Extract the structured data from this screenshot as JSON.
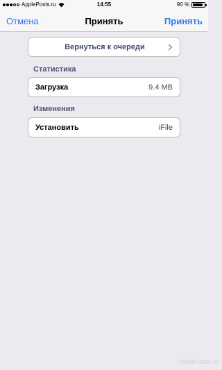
{
  "status_bar": {
    "carrier": "ApplePosts.ru",
    "time": "14:55",
    "battery": "90 %",
    "battery_level": 0.9
  },
  "nav": {
    "cancel_label": "Отмена",
    "title": "Принять",
    "accept_label": "Принять",
    "accent_color": "#3478f6"
  },
  "return_button": {
    "label": "Вернуться к очереди",
    "icon": "chevron-right-icon"
  },
  "sections": {
    "stats": {
      "header": "Статистика",
      "row_label": "Загрузка",
      "row_value": "9.4 MB"
    },
    "changes": {
      "header": "Изменения",
      "row_label": "Установить",
      "row_value": "iFile"
    }
  },
  "watermark": "ApplePosts.ru"
}
